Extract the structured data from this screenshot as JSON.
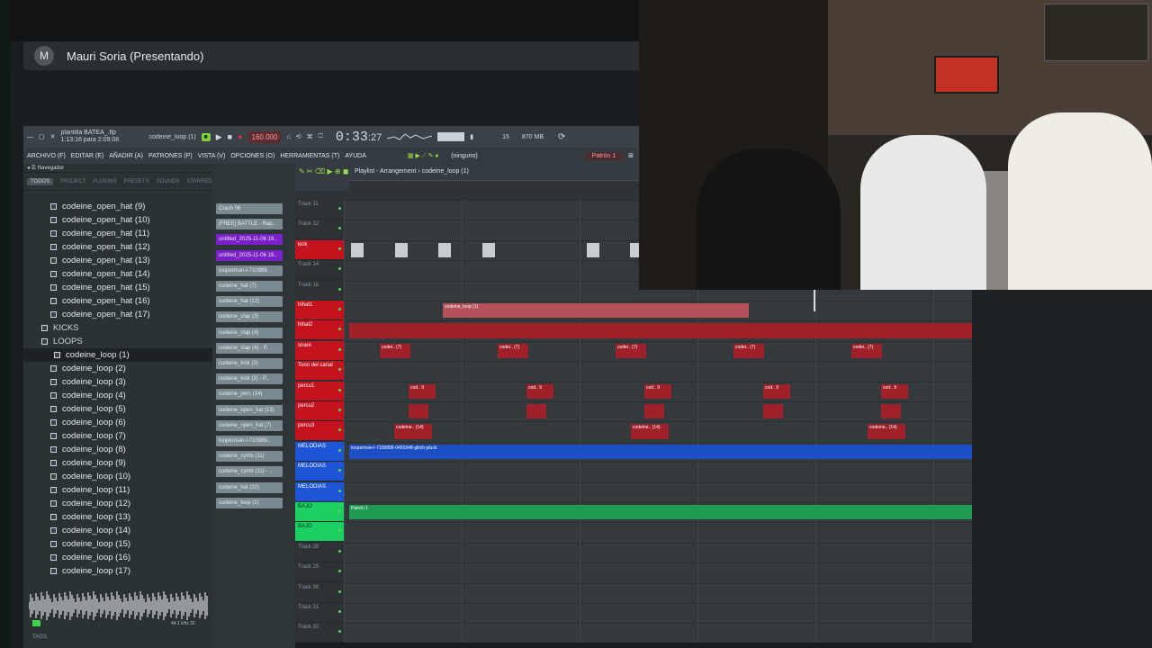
{
  "meeting": {
    "avatar_letter": "M",
    "presenter": "Mauri Soria (Presentando)"
  },
  "fl": {
    "song_info": "plantilla BATEA_.flp",
    "elapsed": "1:13:16 para 2:09:08",
    "hint": "codeine_loop (1)",
    "tempo": "160.000",
    "time": "0:33",
    "time_sub": ":27",
    "cpu": "15",
    "mem": "870 MB",
    "menu": [
      "ARCHIVO (F)",
      "EDITAR (E)",
      "AÑADIR (A)",
      "PATRONES (P)",
      "VISTA (V)",
      "OPCIONES (O)",
      "HERRAMIENTAS (T)",
      "AYUDA"
    ],
    "snap": "(ninguno)",
    "pattern": "Patrón 1",
    "navigator": "Navegador",
    "browser_tabs": [
      "TODOS",
      "PROJECT",
      "PLUGINS",
      "PRESETS",
      "SOUNDS",
      "STARRED"
    ],
    "playlist_title": "Playlist - Arrangement › codeine_loop (1)",
    "sample_rate": "44.1 kHz 32",
    "tags": "TAGS"
  },
  "browser": [
    {
      "label": "codeine_open_hat (9)",
      "type": "file"
    },
    {
      "label": "codeine_open_hat (10)",
      "type": "file"
    },
    {
      "label": "codeine_open_hat (11)",
      "type": "file"
    },
    {
      "label": "codeine_open_hat (12)",
      "type": "file"
    },
    {
      "label": "codeine_open_hat (13)",
      "type": "file"
    },
    {
      "label": "codeine_open_hat (14)",
      "type": "file"
    },
    {
      "label": "codeine_open_hat (15)",
      "type": "file"
    },
    {
      "label": "codeine_open_hat (16)",
      "type": "file"
    },
    {
      "label": "codeine_open_hat (17)",
      "type": "file"
    },
    {
      "label": "KICKS",
      "type": "folder"
    },
    {
      "label": "LOOPS",
      "type": "folder"
    },
    {
      "label": "codeine_loop (1)",
      "type": "file",
      "selected": true
    },
    {
      "label": "codeine_loop (2)",
      "type": "file"
    },
    {
      "label": "codeine_loop (3)",
      "type": "file"
    },
    {
      "label": "codeine_loop (4)",
      "type": "file"
    },
    {
      "label": "codeine_loop (5)",
      "type": "file"
    },
    {
      "label": "codeine_loop (6)",
      "type": "file"
    },
    {
      "label": "codeine_loop (7)",
      "type": "file"
    },
    {
      "label": "codeine_loop (8)",
      "type": "file"
    },
    {
      "label": "codeine_loop (9)",
      "type": "file"
    },
    {
      "label": "codeine_loop (10)",
      "type": "file"
    },
    {
      "label": "codeine_loop (11)",
      "type": "file"
    },
    {
      "label": "codeine_loop (12)",
      "type": "file"
    },
    {
      "label": "codeine_loop (13)",
      "type": "file"
    },
    {
      "label": "codeine_loop (14)",
      "type": "file"
    },
    {
      "label": "codeine_loop (15)",
      "type": "file"
    },
    {
      "label": "codeine_loop (16)",
      "type": "file"
    },
    {
      "label": "codeine_loop (17)",
      "type": "file"
    }
  ],
  "channels": [
    {
      "label": "Crash 06",
      "color": "#7b8a90"
    },
    {
      "label": "[FREE] BATTLE - Rap..",
      "color": "#7b8a90"
    },
    {
      "label": "untitled_2025-11-06 19..",
      "color": "#7a1fc9"
    },
    {
      "label": "untitled_2025-11-06 19..",
      "color": "#7a1fc9"
    },
    {
      "label": "looperman-l-710989..",
      "color": "#7b8a90"
    },
    {
      "label": "codeine_hat (7)",
      "color": "#7b8a90"
    },
    {
      "label": "codeine_hat (12)",
      "color": "#7b8a90"
    },
    {
      "label": "codeine_clap (3)",
      "color": "#7b8a90"
    },
    {
      "label": "codeine_clap (4)",
      "color": "#7b8a90"
    },
    {
      "label": "codeine_clap (4) - P..",
      "color": "#7b8a90"
    },
    {
      "label": "codeine_kick (3)",
      "color": "#7b8a90"
    },
    {
      "label": "codeine_kick (3) - P..",
      "color": "#7b8a90"
    },
    {
      "label": "codeine_perc (14)",
      "color": "#7b8a90"
    },
    {
      "label": "codeine_open_hat (13)",
      "color": "#7b8a90"
    },
    {
      "label": "codeine_open_hat (7)",
      "color": "#7b8a90"
    },
    {
      "label": "looperman-l-710989..",
      "color": "#7b8a90"
    },
    {
      "label": "codeine_cymb (11)",
      "color": "#7b8a90"
    },
    {
      "label": "codeine_cymb (11) - ..",
      "color": "#7b8a90"
    },
    {
      "label": "codeine_hat (32)",
      "color": "#7b8a90"
    },
    {
      "label": "codeine_loop (1)",
      "color": "#7b8a90"
    }
  ],
  "tracks": [
    {
      "label": "Track 11",
      "kind": "plain"
    },
    {
      "label": "Track 12",
      "kind": "plain"
    },
    {
      "label": "kick",
      "kind": "red"
    },
    {
      "label": "Track 14",
      "kind": "plain"
    },
    {
      "label": "Track 15",
      "kind": "plain"
    },
    {
      "label": "hihat1",
      "kind": "red"
    },
    {
      "label": "hihat2",
      "kind": "red"
    },
    {
      "label": "snare",
      "kind": "red"
    },
    {
      "label": "Tono del canal",
      "kind": "red"
    },
    {
      "label": "percu1",
      "kind": "red"
    },
    {
      "label": "percu2",
      "kind": "red"
    },
    {
      "label": "percu3",
      "kind": "red"
    },
    {
      "label": "MELODIAS",
      "kind": "blue"
    },
    {
      "label": "MELODIAS",
      "kind": "blue"
    },
    {
      "label": "MELODIAS",
      "kind": "blue"
    },
    {
      "label": "BAJO",
      "kind": "green"
    },
    {
      "label": "BAJO",
      "kind": "green"
    },
    {
      "label": "Track 28",
      "kind": "plain"
    },
    {
      "label": "Track 29",
      "kind": "plain"
    },
    {
      "label": "Track 30",
      "kind": "plain"
    },
    {
      "label": "Track 31",
      "kind": "plain"
    },
    {
      "label": "Track 32",
      "kind": "plain"
    }
  ],
  "clips": {
    "loop_label": "codeine_loop (1)",
    "snare_label": "codei.. (7)",
    "perc_label": "cod.. 9",
    "perc3_label": "codeine.. (14)",
    "melody_label": "looperman-l-7109896-0451548-glitch-pluck",
    "bass_label": "Patrón 1"
  },
  "colors": {
    "accent_red": "#c4131f",
    "accent_blue": "#1d55d6",
    "accent_green": "#1bcf63"
  }
}
